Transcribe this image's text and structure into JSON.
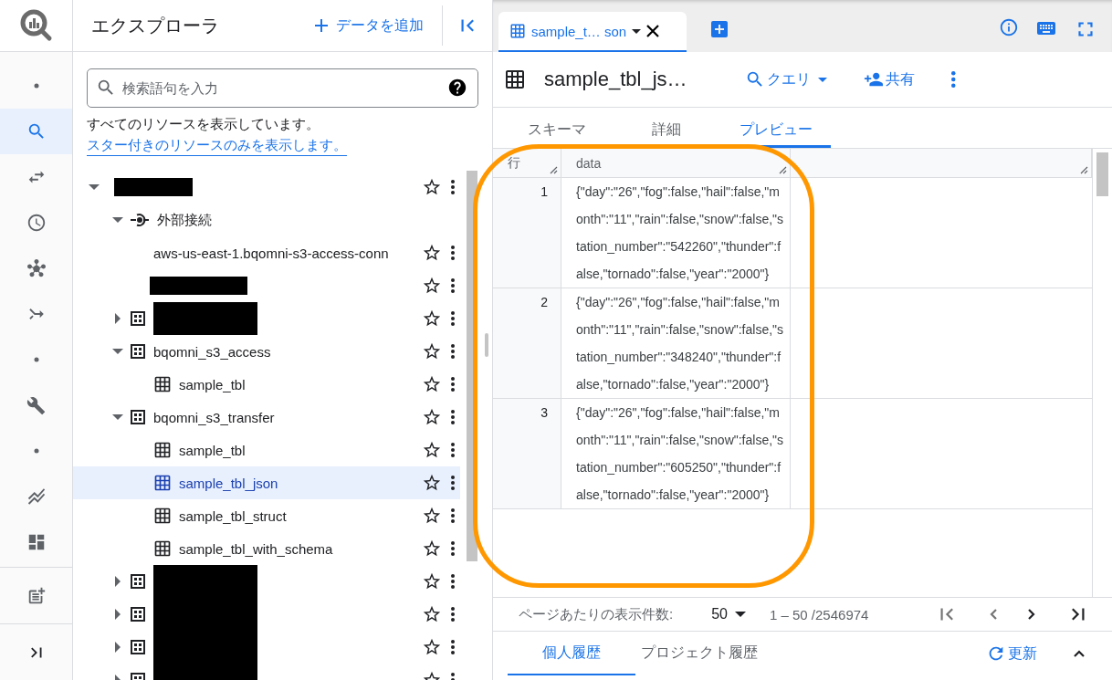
{
  "nav_rail": [
    {
      "kind": "dot",
      "selected": false
    },
    {
      "kind": "search",
      "selected": true
    },
    {
      "kind": "transfer",
      "selected": false
    },
    {
      "kind": "history",
      "selected": false
    },
    {
      "kind": "graph",
      "selected": false
    },
    {
      "kind": "pipeline",
      "selected": false
    },
    {
      "kind": "dot",
      "selected": false
    },
    {
      "kind": "wrench",
      "selected": false
    },
    {
      "kind": "dot",
      "selected": false
    },
    {
      "kind": "chart",
      "selected": false
    },
    {
      "kind": "dashboard",
      "selected": false
    }
  ],
  "rail_footer": [
    {
      "kind": "notes"
    },
    {
      "kind": "expand"
    }
  ],
  "explorer": {
    "title": "エクスプローラ",
    "add_button": "データを追加",
    "search": {
      "placeholder": "検索語句を入力"
    },
    "notice": "すべてのリソースを表示しています。",
    "notice_link": "スター付きのリソースのみを表示します。",
    "tree": [
      {
        "kind": "project",
        "redacted": true,
        "expanded": true,
        "selected": false,
        "children": [
          {
            "kind": "connection",
            "label": "外部接続",
            "expanded": true,
            "selected": false,
            "children": [
              {
                "kind": "connection_item",
                "label": "aws-us-east-1.bqomni-s3-access-conn",
                "selected": false
              },
              {
                "kind": "connection_item",
                "redacted": true,
                "selected": false
              }
            ]
          },
          {
            "kind": "dataset",
            "redacted": true,
            "expanded": false,
            "selected": false
          },
          {
            "kind": "dataset",
            "label": "bqomni_s3_access",
            "expanded": true,
            "selected": false,
            "children": [
              {
                "kind": "table",
                "label": "sample_tbl",
                "selected": false
              }
            ]
          },
          {
            "kind": "dataset",
            "label": "bqomni_s3_transfer",
            "expanded": true,
            "selected": false,
            "children": [
              {
                "kind": "table",
                "label": "sample_tbl",
                "selected": false
              },
              {
                "kind": "table",
                "label": "sample_tbl_json",
                "selected": true
              },
              {
                "kind": "table",
                "label": "sample_tbl_struct",
                "selected": false
              },
              {
                "kind": "table",
                "label": "sample_tbl_with_schema",
                "selected": false
              }
            ]
          },
          {
            "kind": "dataset",
            "redacted": true,
            "expanded": false,
            "selected": false
          },
          {
            "kind": "dataset",
            "redacted": true,
            "expanded": false,
            "selected": false
          },
          {
            "kind": "dataset",
            "redacted": true,
            "expanded": false,
            "selected": false
          },
          {
            "kind": "dataset",
            "redacted": true,
            "expanded": false,
            "selected": false
          }
        ]
      }
    ]
  },
  "editor": {
    "tabs": [
      {
        "label": "sample_t… son",
        "selected": true
      }
    ],
    "title": "sample_tbl_js…",
    "actions": [
      {
        "kind": "query",
        "label": "クエリ"
      },
      {
        "kind": "share",
        "label": "共有"
      }
    ],
    "subtabs": [
      {
        "label": "スキーマ",
        "selected": false
      },
      {
        "label": "詳細",
        "selected": false
      },
      {
        "label": "プレビュー",
        "selected": true
      }
    ],
    "table": {
      "columns": [
        "行",
        "data"
      ],
      "rows": [
        {
          "row": "1",
          "data": "{\"day\":\"26\",\"fog\":false,\"hail\":false,\"month\":\"11\",\"rain\":false,\"snow\":false,\"station_number\":\"542260\",\"thunder\":false,\"tornado\":false,\"year\":\"2000\"}"
        },
        {
          "row": "2",
          "data": "{\"day\":\"26\",\"fog\":false,\"hail\":false,\"month\":\"11\",\"rain\":false,\"snow\":false,\"station_number\":\"348240\",\"thunder\":false,\"tornado\":false,\"year\":\"2000\"}"
        },
        {
          "row": "3",
          "data": "{\"day\":\"26\",\"fog\":false,\"hail\":false,\"month\":\"11\",\"rain\":false,\"snow\":false,\"station_number\":\"605250\",\"thunder\":false,\"tornado\":false,\"year\":\"2000\"}"
        }
      ]
    },
    "pagination": {
      "label": "ページあたりの表示件数:",
      "page_size": "50",
      "range": "1 – 50 /2546974",
      "buttons": [
        {
          "kind": "first",
          "disabled": true
        },
        {
          "kind": "prev",
          "disabled": true
        },
        {
          "kind": "next",
          "disabled": false
        },
        {
          "kind": "last",
          "disabled": false
        }
      ]
    },
    "history": {
      "tabs": [
        {
          "label": "個人履歴",
          "selected": true
        },
        {
          "label": "プロジェクト履歴",
          "selected": false
        }
      ],
      "refresh": "更新"
    }
  }
}
